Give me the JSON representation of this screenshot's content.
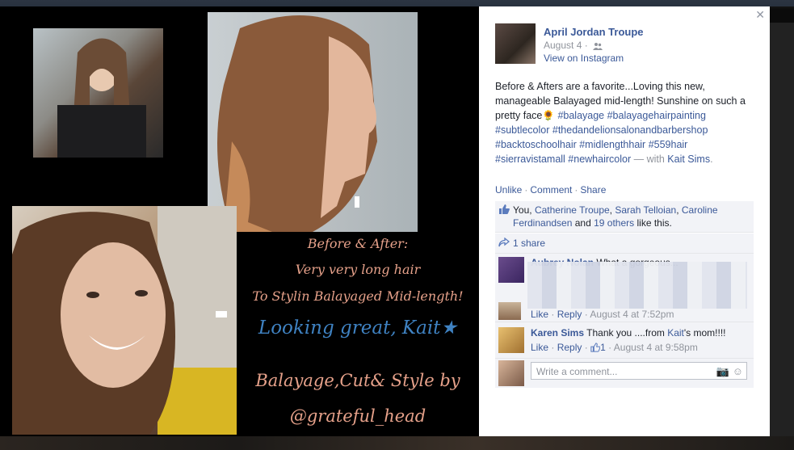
{
  "post": {
    "author": "April Jordan Troupe",
    "date": "August 4 ·",
    "via": "View on Instagram",
    "text_main": "Before & Afters are a favorite...Loving this new, manageable Balayaged mid-length! Sunshine on such a pretty face",
    "sunflower": "🌻",
    "hashtags": "#balayage #balayagehairpainting #subtlecolor #thedandelionsalonandbarbershop #backtoschoolhair #midlengthhair #559hair #sierravistamall #newhaircolor",
    "with": "— with",
    "tagged": "Kait Sims",
    "period": "."
  },
  "actions": {
    "unlike": "Unlike",
    "comment": "Comment",
    "share": "Share"
  },
  "likes": {
    "prefix": "You,",
    "names": [
      "Catherine Troupe",
      "Sarah Telloian",
      "Caroline Ferdinandsen"
    ],
    "and": "and",
    "others": "19 others",
    "suffix": "like this."
  },
  "shares": {
    "label": "1 share"
  },
  "comments": [
    {
      "name": "Aubrey Nolan",
      "text": "What a gorgeous...",
      "like": "Like",
      "reply": "Reply",
      "time": "August 4 at 7:52pm"
    },
    {
      "name": "Karen Sims",
      "text_pre": "Thank you ....from",
      "text_link": "Kait",
      "text_post": "'s mom!!!!",
      "like": "Like",
      "reply": "Reply",
      "like_count": "1",
      "time": "August 4 at 9:58pm"
    }
  ],
  "composer": {
    "placeholder": "Write a comment..."
  },
  "image_caption": {
    "line1": "Before & After:",
    "line2": "Very very  long hair",
    "line3": "To  Stylin Balayaged Mid-length!",
    "line4": "Looking great, Kait★",
    "line5": "Balayage,Cut& Style by",
    "line6": "@grateful_head"
  },
  "colors": {
    "link": "#3b5998",
    "caption_pink": "#e6a18a",
    "caption_blue": "#3f82c2"
  }
}
